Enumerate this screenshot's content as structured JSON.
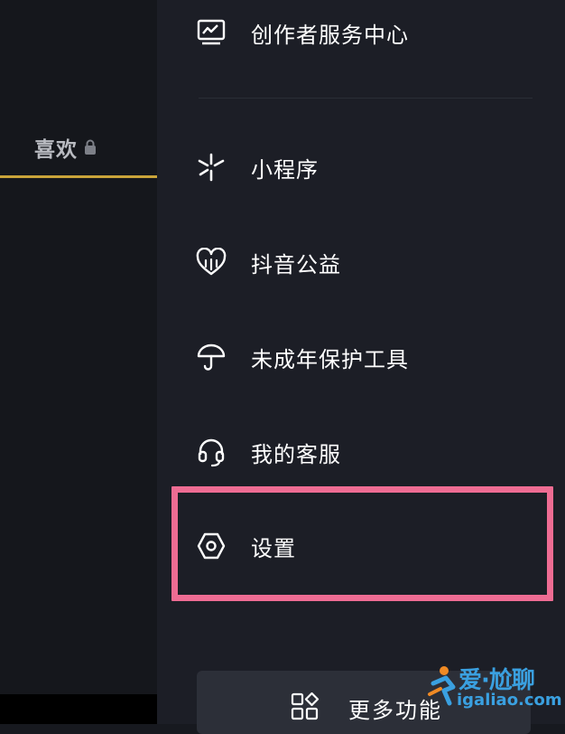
{
  "profile_tabs": {
    "likes_label": "喜欢"
  },
  "menu": {
    "items": [
      {
        "label": "创作者服务中心",
        "icon": "monitor-chart-icon"
      },
      {
        "label": "小程序",
        "icon": "mini-program-icon"
      },
      {
        "label": "抖音公益",
        "icon": "heart-charity-icon"
      },
      {
        "label": "未成年保护工具",
        "icon": "umbrella-icon"
      },
      {
        "label": "我的客服",
        "icon": "headset-icon"
      },
      {
        "label": "设置",
        "icon": "settings-hexagon-icon"
      }
    ],
    "more_label": "更多功能"
  },
  "watermark": {
    "title": "爱·尬聊",
    "url": "igaliao.com"
  },
  "colors": {
    "tab_underline": "#c9a43a",
    "highlight_border": "#ee6c93",
    "drawer_bg": "#1c1e26",
    "watermark": "#3aa0e0"
  }
}
